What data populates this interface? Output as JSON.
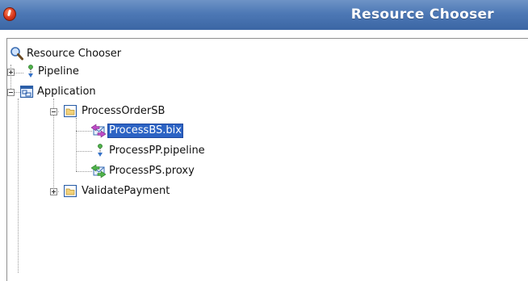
{
  "window": {
    "title": "Resource Chooser",
    "icon": "app-logo-icon"
  },
  "tree": {
    "root": {
      "label": "Resource Chooser",
      "icon": "search-icon"
    },
    "pipeline": {
      "label": "Pipeline",
      "icon": "pipeline-icon",
      "expanded": false
    },
    "application": {
      "label": "Application",
      "icon": "application-icon",
      "expanded": true
    },
    "process_order_sb": {
      "label": "ProcessOrderSB",
      "icon": "folder-icon",
      "expanded": true
    },
    "process_bs": {
      "label": "ProcessBS.bix",
      "icon": "business-service-icon",
      "selected": true
    },
    "process_pp": {
      "label": "ProcessPP.pipeline",
      "icon": "pipeline-icon"
    },
    "process_ps": {
      "label": "ProcessPS.proxy",
      "icon": "proxy-service-icon"
    },
    "validate_payment": {
      "label": "ValidatePayment",
      "icon": "folder-icon",
      "expanded": false
    }
  },
  "colors": {
    "titlebar": "#4d78b5",
    "selection": "#2c63c4",
    "folder": "#f3d27a"
  }
}
